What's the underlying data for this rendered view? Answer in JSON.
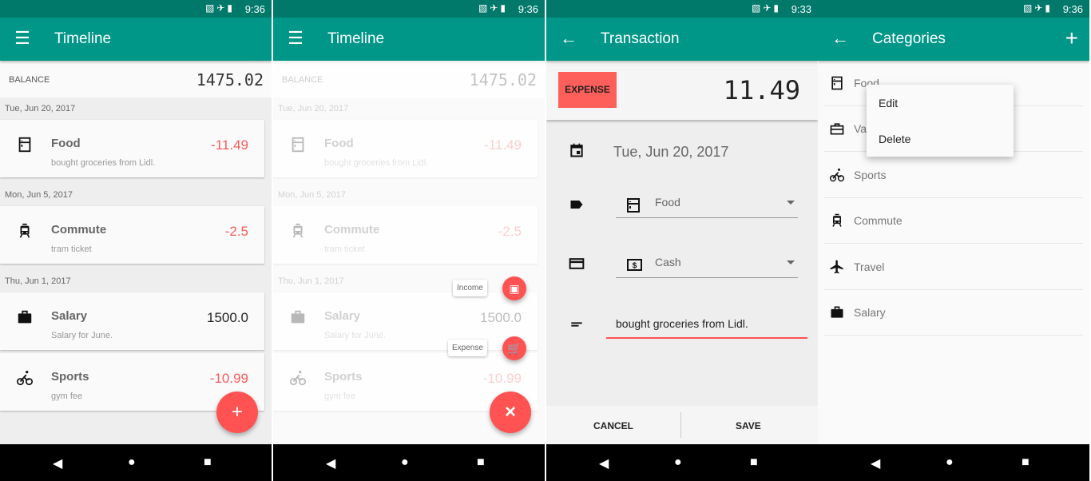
{
  "colors": {
    "primary": "#009688",
    "primary_dark": "#00796b",
    "accent": "#ff5252",
    "expense": "#f55b5b"
  },
  "screens": [
    {
      "time": "9:36",
      "title": "Timeline",
      "nav_icon": "menu-icon"
    },
    {
      "time": "9:36",
      "title": "Timeline",
      "nav_icon": "menu-icon"
    },
    {
      "time": "9:33",
      "title": "Transaction",
      "nav_icon": "back-arrow-icon"
    },
    {
      "time": "9:36",
      "title": "Categories",
      "nav_icon": "back-arrow-icon",
      "action": "+"
    }
  ],
  "timeline": {
    "balance_label": "BALANCE",
    "balance": "1475.02",
    "groups": [
      {
        "date": "Tue, Jun 20, 2017",
        "items": [
          {
            "icon": "fridge-icon",
            "name": "Food",
            "note": "bought groceries from Lidl.",
            "amount": "-11.49",
            "type": "expense"
          }
        ]
      },
      {
        "date": "Mon, Jun 5, 2017",
        "items": [
          {
            "icon": "tram-icon",
            "name": "Commute",
            "note": "tram ticket",
            "amount": "-2.5",
            "type": "expense"
          }
        ]
      },
      {
        "date": "Thu, Jun 1, 2017",
        "items": [
          {
            "icon": "briefcase-icon",
            "name": "Salary",
            "note": "Salary for June.",
            "amount": "1500.0",
            "type": "income"
          },
          {
            "icon": "bike-icon",
            "name": "Sports",
            "note": "gym fee",
            "amount": "-10.99",
            "type": "expense"
          }
        ]
      }
    ],
    "fab": "+",
    "fab_close": "×",
    "fab_menu": [
      {
        "label": "Income",
        "icon": "wallet-icon"
      },
      {
        "label": "Expense",
        "icon": "cart-icon"
      }
    ]
  },
  "transaction": {
    "type_button": "EXPENSE",
    "amount": "11.49",
    "date": "Tue, Jun 20, 2017",
    "category": "Food",
    "account": "Cash",
    "note": "bought groceries from Lidl.",
    "cancel": "CANCEL",
    "save": "SAVE"
  },
  "categories": {
    "items": [
      {
        "name": "Food",
        "icon": "fridge-icon"
      },
      {
        "name": "Va",
        "icon": "suitcase-icon"
      },
      {
        "name": "Sports",
        "icon": "bike-icon"
      },
      {
        "name": "Commute",
        "icon": "tram-icon"
      },
      {
        "name": "Travel",
        "icon": "airplane-icon"
      },
      {
        "name": "Salary",
        "icon": "briefcase-icon"
      }
    ],
    "context_menu": [
      "Edit",
      "Delete"
    ]
  }
}
